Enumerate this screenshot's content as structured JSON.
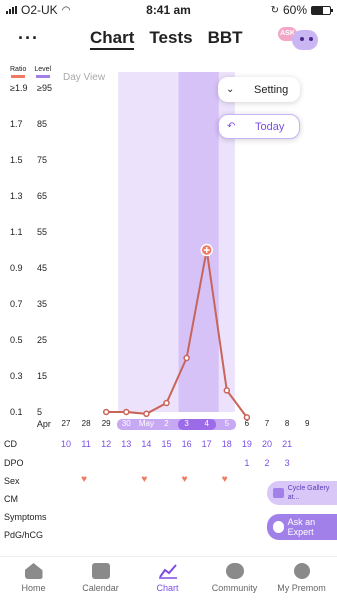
{
  "status": {
    "carrier": "O2-UK",
    "time": "8:41 am",
    "battery": "60%",
    "battery_level": 0.6
  },
  "header": {
    "tabs": [
      {
        "label": "Chart",
        "active": true
      },
      {
        "label": "Tests",
        "active": false
      },
      {
        "label": "BBT",
        "active": false
      }
    ],
    "ask_badge": "ASK"
  },
  "legend": {
    "ratio_label": "Ratio",
    "level_label": "Level",
    "ratio_color": "#f07a63",
    "level_color": "#a280ea"
  },
  "chart": {
    "view_label": "Day View",
    "ratio_ticks": [
      "≥1.9",
      "1.7",
      "1.5",
      "1.3",
      "1.1",
      "0.9",
      "0.7",
      "0.5",
      "0.3",
      "0.1"
    ],
    "level_ticks": [
      "≥95",
      "85",
      "75",
      "65",
      "55",
      "45",
      "35",
      "25",
      "15",
      "5"
    ],
    "setting_label": "Setting",
    "today_label": "Today",
    "highlight_colors": {
      "fertile": "#ece2fb",
      "peak": "#d6c2f7"
    }
  },
  "chart_data": {
    "type": "line",
    "x": [
      "Apr 29",
      "Apr 30",
      "May 1",
      "May 2",
      "May 3",
      "May 4",
      "May 5",
      "May 6"
    ],
    "y": [
      0.1,
      0.1,
      0.09,
      0.15,
      0.4,
      1.0,
      0.22,
      0.07
    ],
    "ylabel": "Ratio",
    "y2label": "Level",
    "ylim": [
      0.1,
      1.9
    ],
    "y2lim": [
      5,
      95
    ],
    "color": "#c9645a",
    "peak_marker_index": 5
  },
  "rows": {
    "date_prefix": "Apr",
    "dates": [
      "27",
      "28",
      "29",
      "30",
      "May",
      "2",
      "3",
      "4",
      "5",
      "6",
      "7",
      "8",
      "9"
    ],
    "cd_label": "CD",
    "cd": [
      "10",
      "11",
      "12",
      "13",
      "14",
      "15",
      "16",
      "17",
      "18",
      "19",
      "20",
      "21"
    ],
    "dpo_label": "DPO",
    "dpo": [
      "1",
      "2",
      "3"
    ],
    "sex_label": "Sex",
    "cm_label": "CM",
    "symptoms_label": "Symptoms",
    "pdg_label": "PdG/hCG"
  },
  "side_chips": {
    "gallery": "Cycle Gallery at...",
    "ask_expert": "Ask an Expert"
  },
  "nav": [
    {
      "label": "Home",
      "icon": "home-icon",
      "active": false
    },
    {
      "label": "Calendar",
      "icon": "calendar-icon",
      "active": false
    },
    {
      "label": "Chart",
      "icon": "chart-icon",
      "active": true
    },
    {
      "label": "Community",
      "icon": "community-icon",
      "active": false
    },
    {
      "label": "My Premom",
      "icon": "premom-icon",
      "active": false
    }
  ]
}
